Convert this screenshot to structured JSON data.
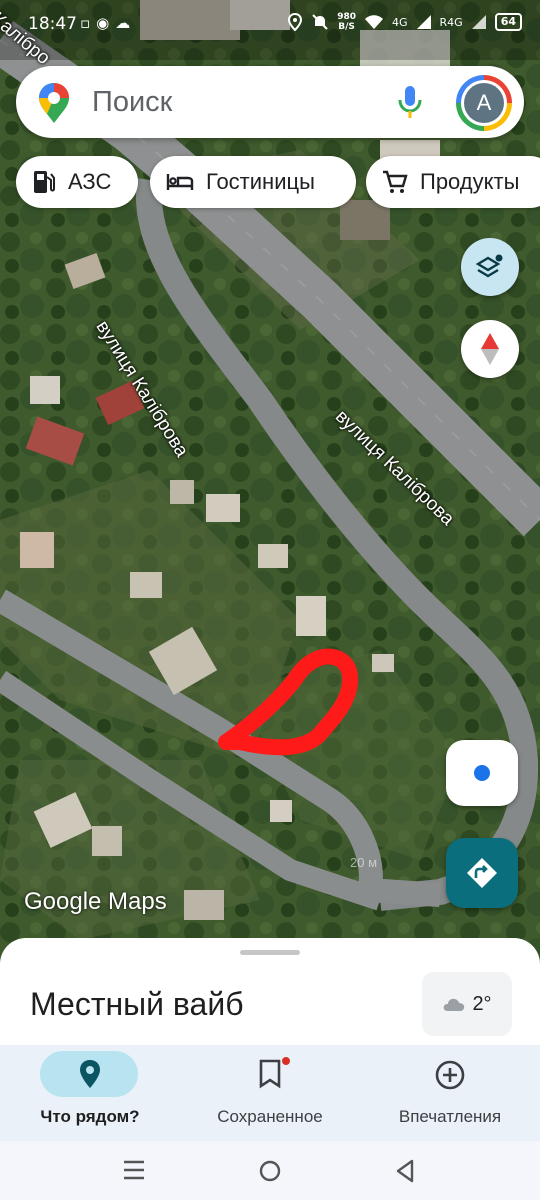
{
  "status_bar": {
    "time": "18:47",
    "left_icons": [
      "vpn-icon",
      "message-icon",
      "weather-icon"
    ],
    "net_speed_value": "980",
    "net_speed_unit": "B/S",
    "network_type_1": "4G",
    "network_type_2": "R4G",
    "battery": "64"
  },
  "search": {
    "placeholder": "Поиск",
    "avatar_letter": "A"
  },
  "chips": [
    {
      "label": "АЗС",
      "icon": "gas-station-icon"
    },
    {
      "label": "Гостиницы",
      "icon": "bed-icon"
    },
    {
      "label": "Продукты",
      "icon": "cart-icon"
    }
  ],
  "map": {
    "street_labels": [
      "вулиця Каліброва",
      "вулиця Каліброва",
      "Калібро"
    ],
    "logo": "Google Maps",
    "scale": "20 м",
    "colors": {
      "marker": "#ff1a1a",
      "road": "#8a8d8f",
      "vegetation": "#3b5a2a"
    }
  },
  "bottom_sheet": {
    "title": "Местный вайб",
    "weather_temp": "2°",
    "weather_icon": "cloud-icon"
  },
  "bottom_nav": [
    {
      "label": "Что рядом?",
      "icon": "location-pin-icon",
      "active": true
    },
    {
      "label": "Сохраненное",
      "icon": "bookmark-icon",
      "active": false
    },
    {
      "label": "Впечатления",
      "icon": "add-circle-icon",
      "active": false
    }
  ]
}
